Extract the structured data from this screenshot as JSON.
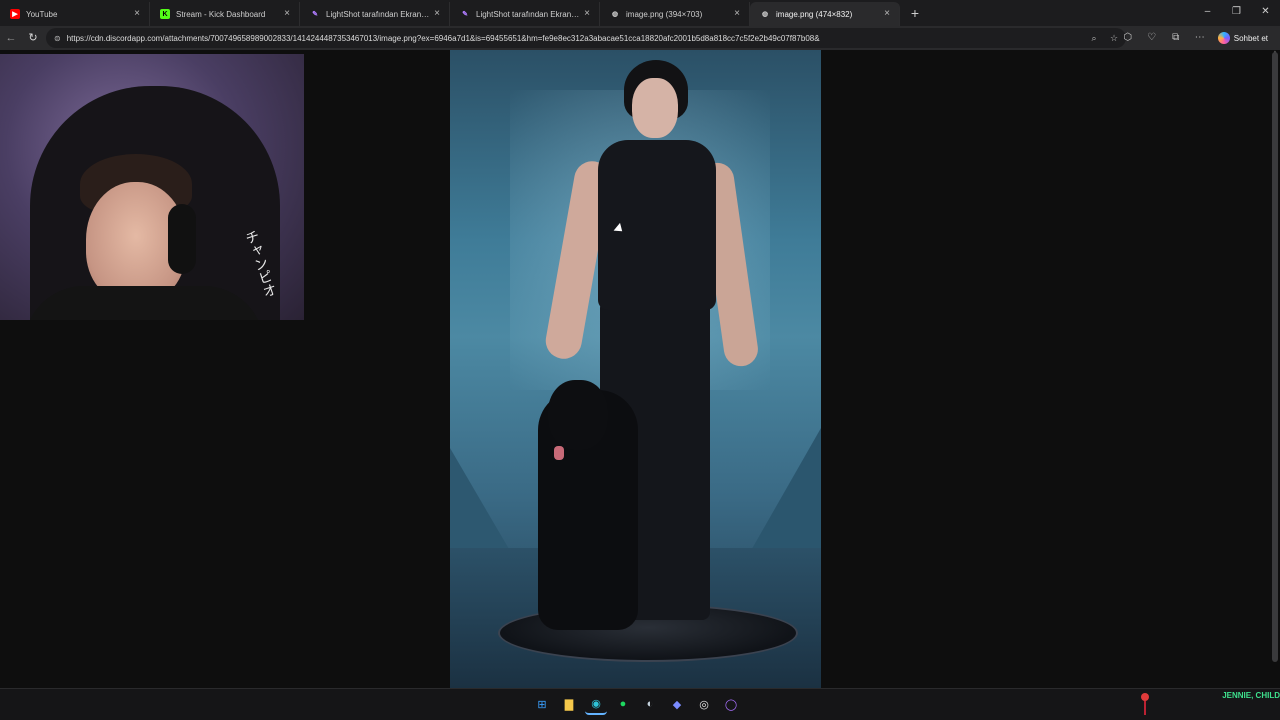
{
  "browser": {
    "tabs": [
      {
        "title": "YouTube",
        "favicon": "youtube-icon",
        "color": "#ff0000",
        "active": false
      },
      {
        "title": "Stream - Kick Dashboard",
        "favicon": "kick-icon",
        "color": "#53fc18",
        "active": false
      },
      {
        "title": "LightShot tarafından Ekran Görüntüsü",
        "favicon": "lightshot-icon",
        "color": "#b07cff",
        "active": false
      },
      {
        "title": "LightShot tarafından Ekran Görüntüsü",
        "favicon": "lightshot-icon",
        "color": "#b07cff",
        "active": false
      },
      {
        "title": "image.png (394×703)",
        "favicon": "globe-icon",
        "color": "#cfcfcf",
        "active": false
      },
      {
        "title": "image.png (474×832)",
        "favicon": "globe-icon",
        "color": "#cfcfcf",
        "active": true
      }
    ],
    "close_glyph": "×",
    "new_tab_glyph": "+",
    "window_controls": {
      "minimize": "–",
      "maximize": "❐",
      "close": "✕"
    },
    "address": {
      "url": "https://cdn.discordapp.com/attachments/700749658989002833/1414244487353467013/image.png?ex=6946a7d1&is=69455651&hm=fe9e8ec312a3abacae51cca18820afc2001b5d8a818cc7c5f2e2b49c07f87b08&"
    },
    "copilot_label": "Sohbet et"
  },
  "webcam": {
    "chair_text": "チャンピオ"
  },
  "taskbar": {
    "apps": [
      {
        "name": "windows-start-icon",
        "glyph": "⊞",
        "color": "#3aa0ff"
      },
      {
        "name": "file-explorer-icon",
        "glyph": "▇",
        "color": "#f5c84b"
      },
      {
        "name": "edge-icon",
        "glyph": "◉",
        "color": "#2fc3d8",
        "active": true
      },
      {
        "name": "spotify-icon",
        "glyph": "●",
        "color": "#1ed760"
      },
      {
        "name": "steam-icon",
        "glyph": "◐",
        "color": "#c6d4df"
      },
      {
        "name": "discord-icon",
        "glyph": "◆",
        "color": "#7b8cff"
      },
      {
        "name": "obs-icon",
        "glyph": "◎",
        "color": "#e8e8e8"
      },
      {
        "name": "twitch-icon",
        "glyph": "◯",
        "color": "#a970ff"
      }
    ],
    "now_playing": "JENNIE, CHILD"
  }
}
